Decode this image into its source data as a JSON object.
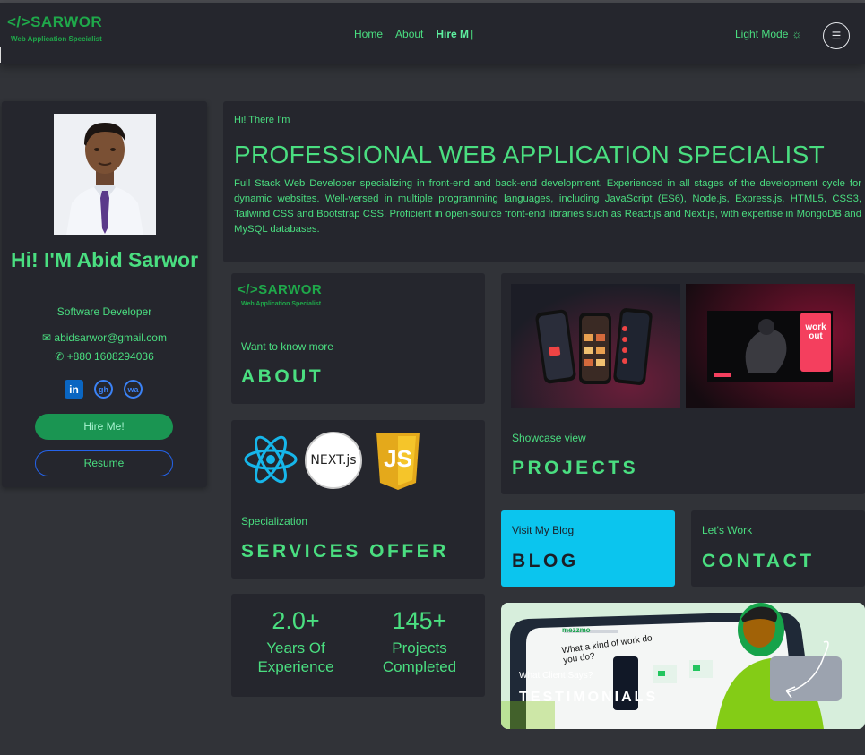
{
  "nav": {
    "logo": "</>SARWOR",
    "logo_sub": "Web Application Specialist",
    "links": [
      "Home",
      "About"
    ],
    "active_link": "Hire M",
    "cursor": "|",
    "mode_toggle": "Light Mode",
    "mode_icon": "☼",
    "menu_icon": "☰"
  },
  "profile": {
    "name": "Hi! I'M Abid Sarwor",
    "role": "Software Developer",
    "email": "abidsarwor@gmail.com",
    "phone": "+880 1608294036",
    "email_icon": "✉",
    "phone_icon": "✆",
    "socials": [
      "in",
      "gh",
      "wa"
    ],
    "hire_button": "Hire Me!",
    "resume_button": "Resume"
  },
  "hero": {
    "greeting": "Hi! There I'm",
    "title": "PROFESSIONAL WEB APPLICATION SPECIALIST",
    "description": "Full Stack Web Developer specializing in front-end and back-end development. Experienced in all stages of the development cycle for dynamic websites. Well-versed in multiple programming languages, including JavaScript (ES6), Node.js, Express.js, HTML5, CSS3, Tailwind CSS and Bootstrap CSS. Proficient in open-source front-end libraries such as React.js and Next.js, with expertise in MongoDB and MySQL databases."
  },
  "about_card": {
    "logo": "</>SARWOR",
    "logo_sub": "Web Application Specialist",
    "subtitle": "Want to know more",
    "title": "ABOUT"
  },
  "services_card": {
    "subtitle": "Specialization",
    "title": "SERVICES OFFER",
    "next_logo": "NEXT.js",
    "js_logo": "JS"
  },
  "stats": [
    {
      "value": "2.0+",
      "label": "Years Of Experience"
    },
    {
      "value": "145+",
      "label": "Projects Completed"
    }
  ],
  "projects_card": {
    "subtitle": "Showcase view",
    "title": "PROJECTS",
    "shot2_text": "work out"
  },
  "blog_card": {
    "subtitle": "Visit My Blog",
    "title": "BLOG"
  },
  "contact_card": {
    "subtitle": "Let's Work",
    "title": "CONTACT"
  },
  "testimonials_card": {
    "subtitle": "What Client Says?",
    "title": "TESTIMONIALS",
    "mock_brand": "mezzmo",
    "mock_question": "What a kind of work do you do?"
  },
  "colors": {
    "accent": "#4ade80",
    "background": "#313338",
    "card": "#25262d",
    "blog": "#0bc5ee",
    "hire_button": "#1a9552"
  }
}
